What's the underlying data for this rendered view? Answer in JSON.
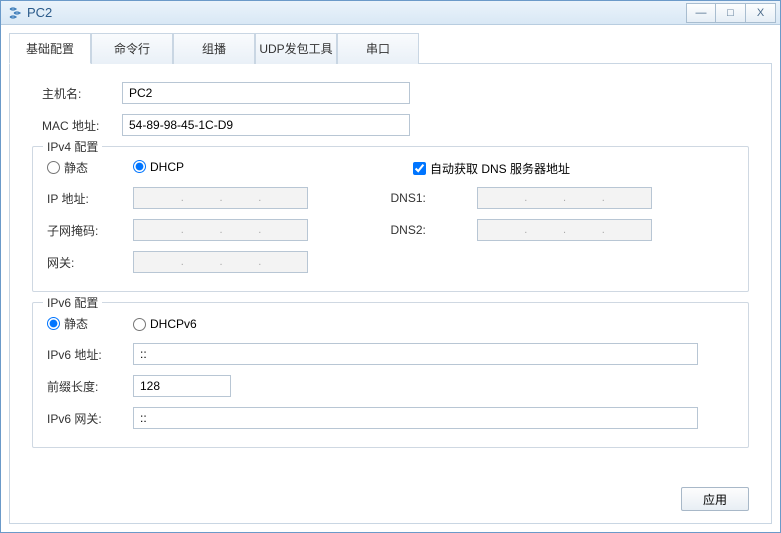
{
  "window": {
    "title": "PC2"
  },
  "tabs": [
    "基础配置",
    "命令行",
    "组播",
    "UDP发包工具",
    "串口"
  ],
  "active_tab": 0,
  "fields": {
    "hostname_label": "主机名:",
    "hostname_value": "PC2",
    "mac_label": "MAC 地址:",
    "mac_value": "54-89-98-45-1C-D9"
  },
  "ipv4": {
    "legend": "IPv4 配置",
    "static_label": "静态",
    "dhcp_label": "DHCP",
    "dhcp_selected": true,
    "auto_dns_label": "自动获取 DNS 服务器地址",
    "auto_dns_checked": true,
    "ip_label": "IP 地址:",
    "mask_label": "子网掩码:",
    "gw_label": "网关:",
    "dns1_label": "DNS1:",
    "dns2_label": "DNS2:"
  },
  "ipv6": {
    "legend": "IPv6 配置",
    "static_label": "静态",
    "dhcp_label": "DHCPv6",
    "static_selected": true,
    "addr_label": "IPv6 地址:",
    "addr_value": "::",
    "prefix_label": "前缀长度:",
    "prefix_value": "128",
    "gw_label": "IPv6 网关:",
    "gw_value": "::"
  },
  "apply_label": "应用"
}
